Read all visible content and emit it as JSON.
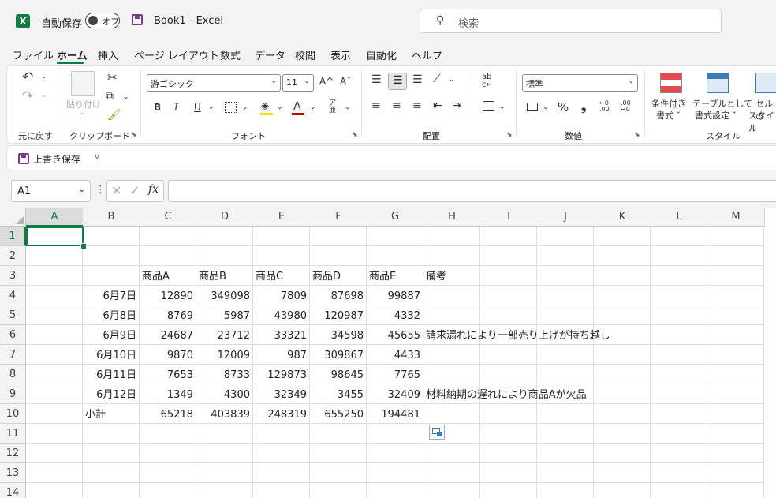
{
  "titlebar": {
    "autosave_label": "自動保存",
    "autosave_state": "オフ",
    "document_title": "Book1  -  Excel",
    "search_placeholder": "検索"
  },
  "tabs": [
    "ファイル",
    "ホーム",
    "挿入",
    "ページ レイアウト",
    "数式",
    "データ",
    "校閲",
    "表示",
    "自動化",
    "ヘルプ"
  ],
  "active_tab": "ホーム",
  "ribbon": {
    "undo_group": "元に戻す",
    "paste_label": "貼り付け",
    "clipboard_group": "クリップボード",
    "font_name": "游ゴシック",
    "font_size": "11",
    "grow_font": "A^",
    "shrink_font": "Aˇ",
    "bold": "B",
    "italic": "I",
    "underline": "U",
    "font_color_glyph": "A",
    "font_group": "フォント",
    "alignment_group": "配置",
    "number_format": "標準",
    "percent": "%",
    "comma": "❟",
    "number_group": "数値",
    "cond_format_l1": "条件付き",
    "cond_format_l2": "書式 ˇ",
    "table_format_l1": "テーブルとして",
    "table_format_l2": "書式設定 ˇ",
    "cell_style_l1": "セルの",
    "cell_style_l2": "スタイル",
    "styles_group": "スタイル",
    "accent_green": "#107c41",
    "accent_red": "#c00000",
    "accent_yellow": "#ffd700"
  },
  "qat": {
    "overwrite_save": "上書き保存",
    "customize": "▿"
  },
  "formula_bar": {
    "name_box": "A1",
    "fx": "fx",
    "formula": ""
  },
  "grid": {
    "columns": [
      "A",
      "B",
      "C",
      "D",
      "E",
      "F",
      "G",
      "H",
      "I",
      "J",
      "K",
      "L",
      "M"
    ],
    "rows": [
      "1",
      "2",
      "3",
      "4",
      "5",
      "6",
      "7",
      "8",
      "9",
      "10",
      "11",
      "12",
      "13",
      "14"
    ],
    "selected_cell": "A1",
    "cells": [
      {
        "r": 3,
        "c": "C",
        "v": "商品A",
        "num": false
      },
      {
        "r": 3,
        "c": "D",
        "v": "商品B",
        "num": false
      },
      {
        "r": 3,
        "c": "E",
        "v": "商品C",
        "num": false
      },
      {
        "r": 3,
        "c": "F",
        "v": "商品D",
        "num": false
      },
      {
        "r": 3,
        "c": "G",
        "v": "商品E",
        "num": false
      },
      {
        "r": 3,
        "c": "H",
        "v": "備考",
        "num": false
      },
      {
        "r": 4,
        "c": "B",
        "v": "6月7日",
        "num": true
      },
      {
        "r": 4,
        "c": "C",
        "v": "12890",
        "num": true
      },
      {
        "r": 4,
        "c": "D",
        "v": "349098",
        "num": true
      },
      {
        "r": 4,
        "c": "E",
        "v": "7809",
        "num": true
      },
      {
        "r": 4,
        "c": "F",
        "v": "87698",
        "num": true
      },
      {
        "r": 4,
        "c": "G",
        "v": "99887",
        "num": true
      },
      {
        "r": 5,
        "c": "B",
        "v": "6月8日",
        "num": true
      },
      {
        "r": 5,
        "c": "C",
        "v": "8769",
        "num": true
      },
      {
        "r": 5,
        "c": "D",
        "v": "5987",
        "num": true
      },
      {
        "r": 5,
        "c": "E",
        "v": "43980",
        "num": true
      },
      {
        "r": 5,
        "c": "F",
        "v": "120987",
        "num": true
      },
      {
        "r": 5,
        "c": "G",
        "v": "4332",
        "num": true
      },
      {
        "r": 6,
        "c": "B",
        "v": "6月9日",
        "num": true
      },
      {
        "r": 6,
        "c": "C",
        "v": "24687",
        "num": true
      },
      {
        "r": 6,
        "c": "D",
        "v": "23712",
        "num": true
      },
      {
        "r": 6,
        "c": "E",
        "v": "33321",
        "num": true
      },
      {
        "r": 6,
        "c": "F",
        "v": "34598",
        "num": true
      },
      {
        "r": 6,
        "c": "G",
        "v": "45655",
        "num": true
      },
      {
        "r": 6,
        "c": "H",
        "v": "請求漏れにより一部売り上げが持ち越し",
        "num": false
      },
      {
        "r": 7,
        "c": "B",
        "v": "6月10日",
        "num": true
      },
      {
        "r": 7,
        "c": "C",
        "v": "9870",
        "num": true
      },
      {
        "r": 7,
        "c": "D",
        "v": "12009",
        "num": true
      },
      {
        "r": 7,
        "c": "E",
        "v": "987",
        "num": true
      },
      {
        "r": 7,
        "c": "F",
        "v": "309867",
        "num": true
      },
      {
        "r": 7,
        "c": "G",
        "v": "4433",
        "num": true
      },
      {
        "r": 8,
        "c": "B",
        "v": "6月11日",
        "num": true
      },
      {
        "r": 8,
        "c": "C",
        "v": "7653",
        "num": true
      },
      {
        "r": 8,
        "c": "D",
        "v": "8733",
        "num": true
      },
      {
        "r": 8,
        "c": "E",
        "v": "129873",
        "num": true
      },
      {
        "r": 8,
        "c": "F",
        "v": "98645",
        "num": true
      },
      {
        "r": 8,
        "c": "G",
        "v": "7765",
        "num": true
      },
      {
        "r": 9,
        "c": "B",
        "v": "6月12日",
        "num": true
      },
      {
        "r": 9,
        "c": "C",
        "v": "1349",
        "num": true
      },
      {
        "r": 9,
        "c": "D",
        "v": "4300",
        "num": true
      },
      {
        "r": 9,
        "c": "E",
        "v": "32349",
        "num": true
      },
      {
        "r": 9,
        "c": "F",
        "v": "3455",
        "num": true
      },
      {
        "r": 9,
        "c": "G",
        "v": "32409",
        "num": true
      },
      {
        "r": 9,
        "c": "H",
        "v": "材料納期の遅れにより商品Aが欠品",
        "num": false
      },
      {
        "r": 10,
        "c": "B",
        "v": "小計",
        "num": false
      },
      {
        "r": 10,
        "c": "C",
        "v": "65218",
        "num": true
      },
      {
        "r": 10,
        "c": "D",
        "v": "403839",
        "num": true
      },
      {
        "r": 10,
        "c": "E",
        "v": "248319",
        "num": true
      },
      {
        "r": 10,
        "c": "F",
        "v": "655250",
        "num": true
      },
      {
        "r": 10,
        "c": "G",
        "v": "194481",
        "num": true
      }
    ]
  }
}
